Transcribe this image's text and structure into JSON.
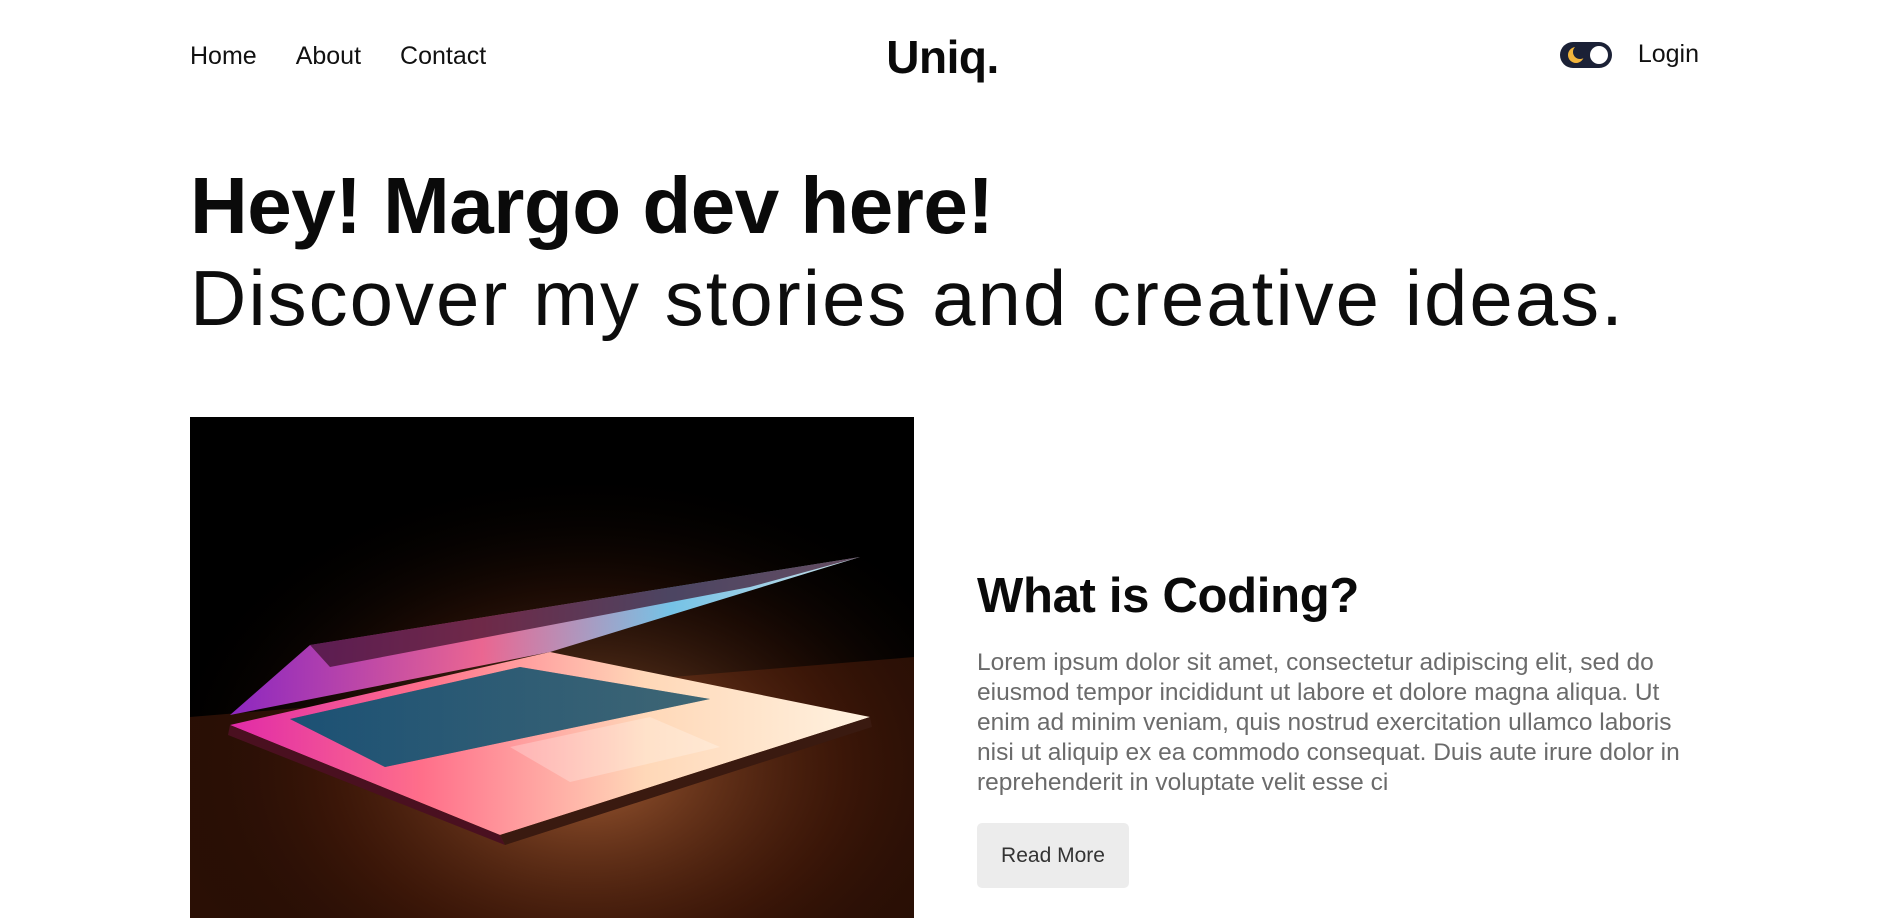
{
  "brand": {
    "logo": "Uniq."
  },
  "nav": {
    "items": [
      {
        "label": "Home"
      },
      {
        "label": "About"
      },
      {
        "label": "Contact"
      }
    ],
    "login_label": "Login",
    "theme_toggle_icon": "moon-icon"
  },
  "hero": {
    "title": "Hey! Margo dev here!",
    "subtitle": "Discover my stories and creative ideas."
  },
  "featured_post": {
    "image_icon": "laptop-photo",
    "title": "What is Coding?",
    "excerpt": "Lorem ipsum dolor sit amet, consectetur adipiscing elit, sed do eiusmod tempor incididunt ut labore et dolore magna aliqua. Ut enim ad minim veniam, quis nostrud exercitation ullamco laboris nisi ut aliquip ex ea commodo consequat. Duis aute irure dolor in reprehenderit in voluptate velit esse ci",
    "read_more_label": "Read More"
  },
  "colors": {
    "text": "#0a0a0a",
    "muted_text": "#6b6b6b",
    "toggle_bg": "#1b2136",
    "moon": "#f2b53c",
    "button_bg": "#ececec"
  }
}
